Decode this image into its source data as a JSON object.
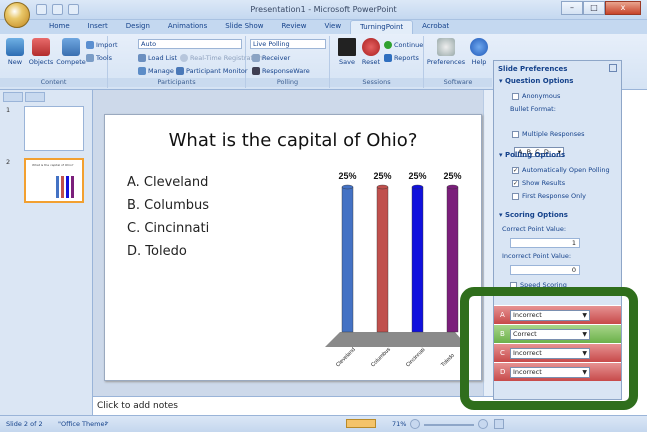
{
  "window": {
    "title": "Presentation1 - Microsoft PowerPoint",
    "orb_label": "Office",
    "minimize": "–",
    "maximize": "□",
    "close": "x"
  },
  "ribbon_tabs": [
    "Home",
    "Insert",
    "Design",
    "Animations",
    "Slide Show",
    "Review",
    "View",
    "TurningPoint",
    "Acrobat"
  ],
  "active_tab": "TurningPoint",
  "ribbon": {
    "content": {
      "label": "Content",
      "new": "New",
      "objects": "Objects",
      "compete": "Compete",
      "import": "Import",
      "tools": "Tools"
    },
    "participants": {
      "label": "Participants",
      "auto": "Auto",
      "load_list": "Load List",
      "realtime": "Real-Time Registration",
      "manage": "Manage",
      "monitor": "Participant Monitor"
    },
    "polling": {
      "label": "Polling",
      "live": "Live Polling",
      "receiver": "Receiver",
      "responseware": "ResponseWare"
    },
    "sessions": {
      "label": "Sessions",
      "save": "Save",
      "reset": "Reset",
      "continue": "Continue",
      "reports": "Reports"
    },
    "software": {
      "label": "Software",
      "preferences": "Preferences",
      "help": "Help"
    }
  },
  "slides": [
    {
      "number": "1"
    },
    {
      "number": "2",
      "title": "What is the capital of Ohio?"
    }
  ],
  "slide": {
    "title": "What is the capital of Ohio?",
    "answers": [
      "A.  Cleveland",
      "B.  Columbus",
      "C.  Cincinnati",
      "D.  Toledo"
    ]
  },
  "chart_data": {
    "type": "bar",
    "categories": [
      "Cleveland",
      "Columbus",
      "Cincinnati",
      "Toledo"
    ],
    "values": [
      25,
      25,
      25,
      25
    ],
    "data_labels": [
      "25%",
      "25%",
      "25%",
      "25%"
    ],
    "colors": [
      "#4472c4",
      "#c0504d",
      "#1111dd",
      "#7b1f7b"
    ],
    "ylim": [
      0,
      25
    ]
  },
  "notes_placeholder": "Click to add notes",
  "pane": {
    "title": "Slide Preferences",
    "question_options": "Question Options",
    "anonymous": "Anonymous",
    "bullet_format_label": "Bullet Format:",
    "bullet_format_value": "A, B, C, D",
    "multiple_responses": "Multiple Responses",
    "polling_options": "Polling Options",
    "auto_open": "Automatically Open Polling",
    "show_results": "Show Results",
    "first_response": "First Response Only",
    "scoring_options": "Scoring Options",
    "correct_label": "Correct Point Value:",
    "correct_value": "1",
    "incorrect_label": "Incorrect Point Value:",
    "incorrect_value": "0",
    "speed_scoring": "Speed Scoring"
  },
  "answer_values": [
    {
      "letter": "A",
      "value": "Incorrect",
      "status": "incorrect"
    },
    {
      "letter": "B",
      "value": "Correct",
      "status": "correct"
    },
    {
      "letter": "C",
      "value": "Incorrect",
      "status": "incorrect"
    },
    {
      "letter": "D",
      "value": "Incorrect",
      "status": "incorrect"
    }
  ],
  "status": {
    "slide": "Slide 2 of 2",
    "theme": "\"Office Theme\"",
    "zoom": "71%"
  }
}
